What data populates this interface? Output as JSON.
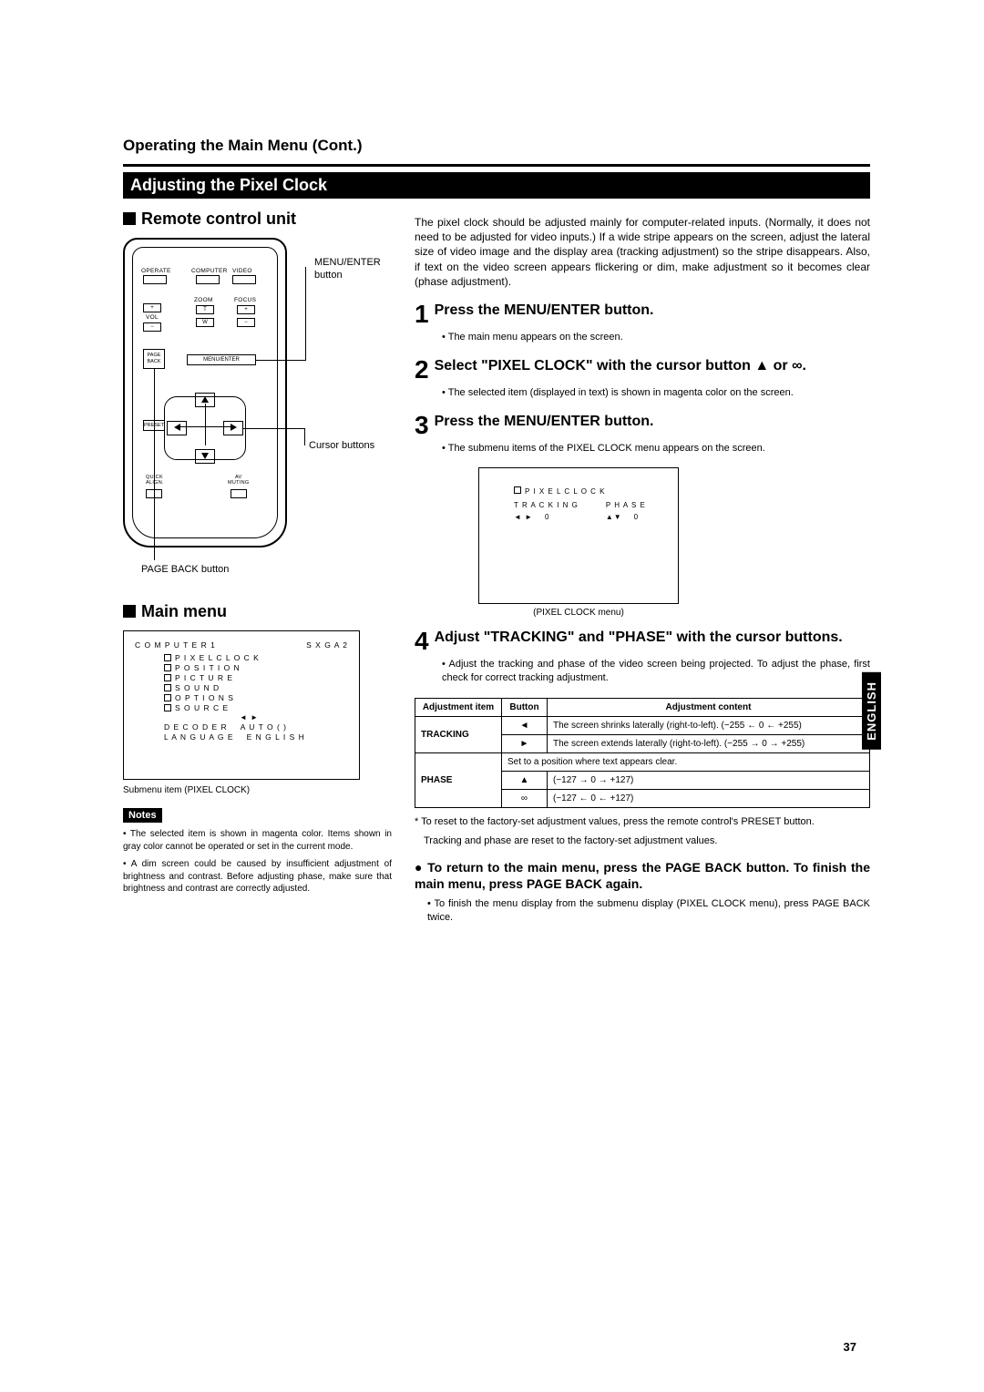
{
  "header": "Operating the Main Menu (Cont.)",
  "section_bar": "Adjusting the Pixel Clock",
  "remote_heading": "Remote control unit",
  "main_menu_heading": "Main menu",
  "remote": {
    "menu_enter_label": "MENU/ENTER\nbutton",
    "cursor_label": "Cursor buttons",
    "page_back_label": "PAGE BACK button",
    "labels": {
      "operate": "OPERATE",
      "computer": "COMPUTER",
      "video": "VIDEO",
      "vol": "VOL",
      "zoom": "ZOOM",
      "focus": "FOCUS",
      "t": "T",
      "w": "W",
      "plus": "+",
      "minus": "−",
      "page_back": "PAGE\nBACK",
      "menu_enter": "MENU/ENTER",
      "preset": "PRESET",
      "quick_align": "QUICK\nALIGN.",
      "av_muting": "AV\nMUTING"
    }
  },
  "menu": {
    "top_left": "C O M P U T E R 1",
    "top_right": "S X G A 2",
    "items": [
      "P I X E L   C L O C K",
      "P O S I T I O N",
      "P I C T U R E",
      "S O U N D",
      "O P T I O N S",
      "S O U R C E"
    ],
    "decoder_l": "D E C O D E R",
    "decoder_r": "A U T O (            )",
    "lang_l": "L A N G U A G E",
    "lang_r": "E N G L I S H",
    "caption": "Submenu item (PIXEL CLOCK)"
  },
  "notes_label": "Notes",
  "notes": [
    "The selected item is shown in magenta color. Items shown in gray color cannot be operated or set in the current mode.",
    "A dim screen could be caused by insufficient adjustment of brightness and contrast. Before adjusting phase, make sure that brightness and contrast are correctly adjusted."
  ],
  "intro": "The pixel clock should be adjusted mainly for computer-related inputs. (Normally, it does not need to be adjusted for video inputs.) If a wide stripe appears on the screen, adjust the lateral size of video image and the display area (tracking adjustment) so the stripe disappears. Also, if text on the video screen appears flickering or dim, make adjustment so it becomes clear (phase adjustment).",
  "steps": [
    {
      "num": "1",
      "title": "Press the MENU/ENTER button.",
      "bullets": [
        "The main menu appears on the screen."
      ]
    },
    {
      "num": "2",
      "title": "Select \"PIXEL CLOCK\" with the cursor button ▲ or ∞.",
      "bullets": [
        "The selected item (displayed in text) is shown in magenta color on the screen."
      ]
    },
    {
      "num": "3",
      "title": "Press the MENU/ENTER button.",
      "bullets": [
        "The submenu items of the PIXEL CLOCK menu appears on the screen."
      ]
    }
  ],
  "pc_menu": {
    "title": "P I X E L   C L O C K",
    "tracking_l": "T R A C K I N G",
    "phase_l": "P H A S E",
    "tracking_v": "0",
    "phase_v": "0",
    "caption": "(PIXEL CLOCK menu)"
  },
  "step4": {
    "num": "4",
    "title": "Adjust \"TRACKING\" and \"PHASE\" with the cursor buttons.",
    "bullet": "Adjust the tracking and phase of the video screen being projected. To adjust the phase, first check for correct tracking adjustment."
  },
  "table": {
    "h1": "Adjustment item",
    "h2": "Button",
    "h3": "Adjustment content",
    "rows": [
      {
        "item": "TRACKING",
        "btn": "◄",
        "content": "The screen shrinks laterally (right-to-left). (−255 ← 0 ← +255)"
      },
      {
        "item": "",
        "btn": "►",
        "content": "The screen extends laterally (right-to-left). (−255 → 0 → +255)"
      },
      {
        "item": "PHASE",
        "btn": "",
        "content": "Set to a position where text appears clear."
      },
      {
        "item": "",
        "btn": "▲",
        "content": "(−127 → 0 → +127)"
      },
      {
        "item": "",
        "btn": "∞",
        "content": "(−127 ← 0 ← +127)"
      }
    ]
  },
  "footnote1": "* To reset to the factory-set adjustment values, press the remote control's PRESET button.",
  "footnote2": "Tracking and phase are reset to the factory-set adjustment values.",
  "return_h": "To return to the main menu, press the PAGE BACK button. To finish the main menu, press PAGE BACK again.",
  "return_bullet": "To finish the menu display from the submenu display (PIXEL CLOCK menu), press PAGE BACK twice.",
  "side_tab": "ENGLISH",
  "page_num": "37"
}
